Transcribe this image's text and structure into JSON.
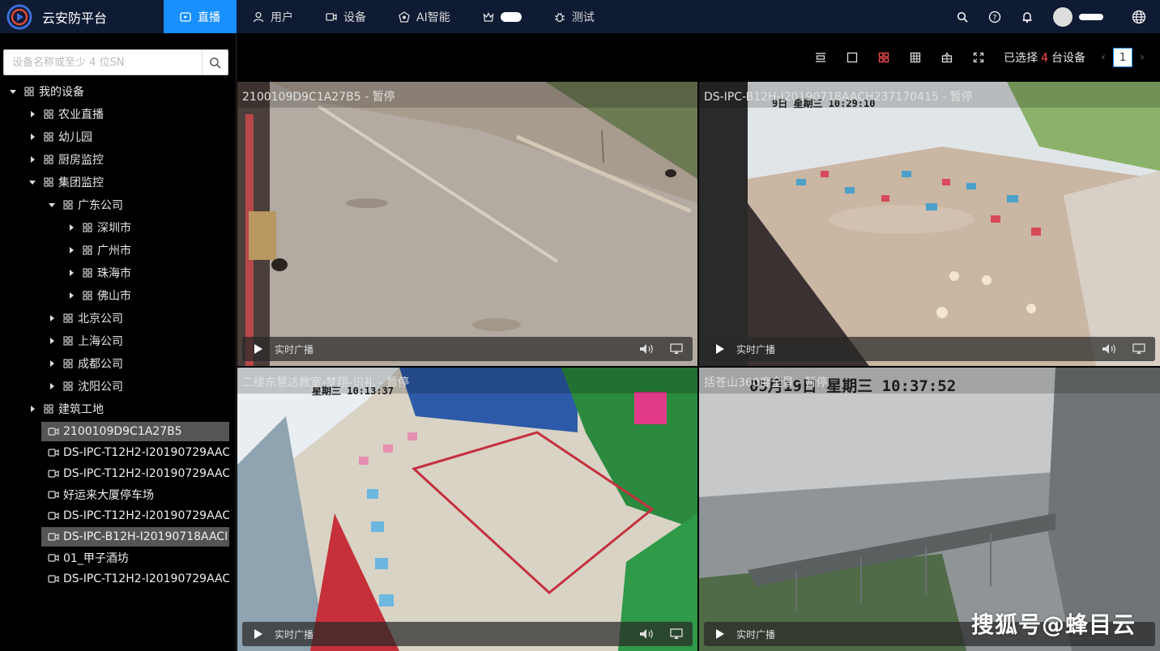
{
  "app": {
    "title": "云安防平台"
  },
  "nav": [
    {
      "label": "直播",
      "icon": "live-play-icon",
      "active": true
    },
    {
      "label": "用户",
      "icon": "user-icon",
      "active": false
    },
    {
      "label": "设备",
      "icon": "device-camera-icon",
      "active": false
    },
    {
      "label": "AI智能",
      "icon": "ai-brain-icon",
      "active": false
    },
    {
      "label": "",
      "icon": "crown-icon",
      "active": false
    },
    {
      "label": "测试",
      "icon": "bug-icon",
      "active": false
    }
  ],
  "search": {
    "placeholder": "设备名称或至少 4 位SN"
  },
  "tree": {
    "root": "我的设备",
    "groups": [
      "农业直播",
      "幼儿园",
      "厨房监控",
      "集团监控"
    ],
    "sub_group": "广东公司",
    "cities": [
      "深圳市",
      "广州市",
      "珠海市",
      "佛山市"
    ],
    "companies": [
      "北京公司",
      "上海公司",
      "成都公司",
      "沈阳公司"
    ],
    "last_group": "建筑工地",
    "devices": [
      {
        "name": "2100109D9C1A27B5",
        "selected": true
      },
      {
        "name": "DS-IPC-T12H2-I20190729AAC",
        "selected": false
      },
      {
        "name": "DS-IPC-T12H2-I20190729AAC",
        "selected": false
      },
      {
        "name": "好运来大厦停车场",
        "selected": false
      },
      {
        "name": "DS-IPC-T12H2-I20190729AAC",
        "selected": false
      },
      {
        "name": "DS-IPC-B12H-I20190718AACI",
        "selected": true
      },
      {
        "name": "01_甲子酒坊",
        "selected": false
      },
      {
        "name": "DS-IPC-T12H2-I20190729AAC",
        "selected": false
      }
    ]
  },
  "toolbar": {
    "selected_prefix": "已选择",
    "selected_count": "4",
    "selected_suffix": "台设备",
    "page": "1"
  },
  "panes": [
    {
      "title": "2100109D9C1A27B5 - 暂停",
      "live_label": "实时广播"
    },
    {
      "title": "DS-IPC-B12H-I20190718AACH237170415 - 暂停",
      "live_label": "实时广播",
      "osd": "9日 星期三 10:29:10"
    },
    {
      "title": "二楼东慧达教室-梦翔-识礼 - 暂停",
      "live_label": "实时广播",
      "osd": "星期三 10:13:37"
    },
    {
      "title": "括苍山360度全景 - 暂停",
      "live_label": "实时广播",
      "osd": "05月19日 星期三 10:37:52"
    }
  ],
  "watermark": "搜狐号@蜂目云",
  "colors": {
    "topbar": "#0f1a33",
    "accent": "#1890ff",
    "active_layout": "#ff4d4f"
  }
}
